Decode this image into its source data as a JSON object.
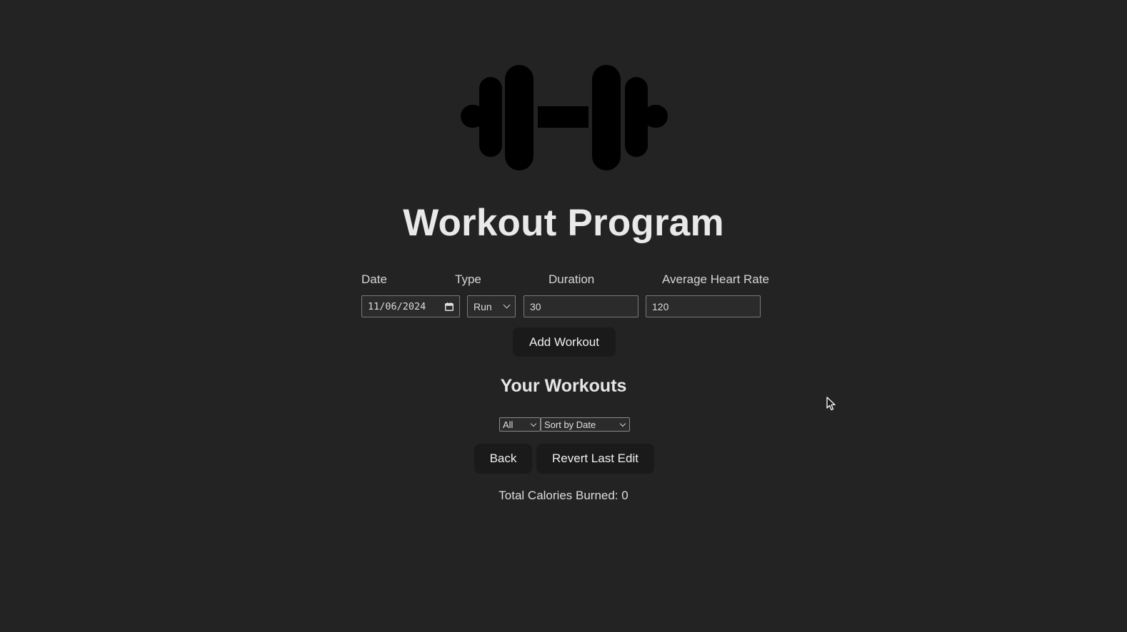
{
  "logo": {
    "icon": "dumbbell-icon",
    "color": "#000000"
  },
  "title": "Workout Program",
  "form": {
    "labels": {
      "date": "Date",
      "type": "Type",
      "duration": "Duration",
      "heart_rate": "Average Heart Rate"
    },
    "date_value": "11/06/2024",
    "type_value": "Run",
    "duration_value": "30",
    "heart_rate_value": "120",
    "add_button": "Add Workout"
  },
  "workouts": {
    "heading": "Your Workouts",
    "filter_value": "All",
    "sort_value": "Sort by Date",
    "back_button": "Back",
    "revert_button": "Revert Last Edit",
    "calories_text": "Total Calories Burned: 0"
  },
  "colors": {
    "background": "#232323",
    "button_bg": "#1a1a1a",
    "text": "#e6e6e6"
  }
}
